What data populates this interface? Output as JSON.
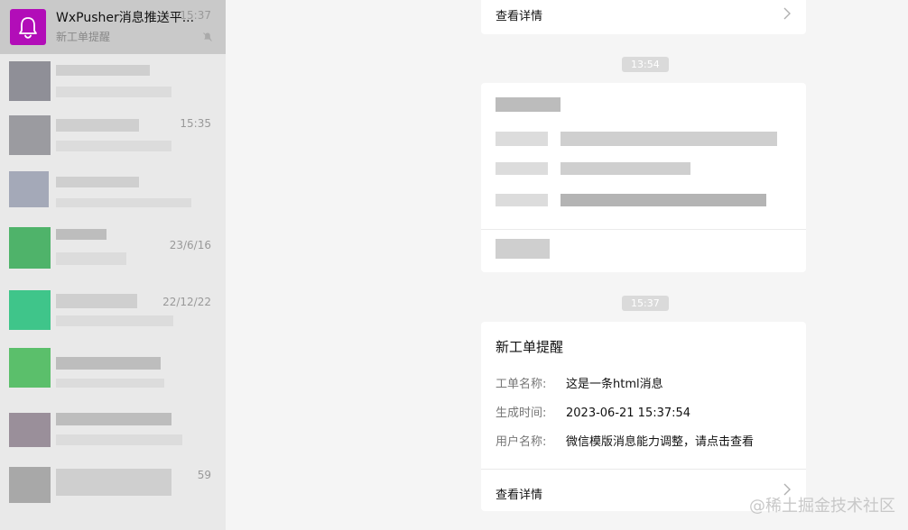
{
  "sidebar": {
    "active_chat": {
      "name": "WxPusher消息推送平...",
      "time": "15:37",
      "preview": "新工单提醒",
      "avatar_icon": "bell-icon",
      "avatar_color": "#b20db8"
    },
    "other_items": [
      {
        "time": ""
      },
      {
        "time": "15:35"
      },
      {
        "time": ""
      },
      {
        "time": "23/6/16"
      },
      {
        "time": "22/12/22"
      },
      {
        "time": ""
      },
      {
        "time": ""
      },
      {
        "time": "59"
      }
    ]
  },
  "chat": {
    "top_card": {
      "detail_label": "查看详情"
    },
    "time_1": "13:54",
    "time_2": "15:37",
    "notify_card": {
      "title": "新工单提醒",
      "fields": [
        {
          "label": "工单名称:",
          "value": "这是一条html消息"
        },
        {
          "label": "生成时间:",
          "value": "2023-06-21 15:37:54"
        },
        {
          "label": "用户名称:",
          "value": "微信模版消息能力调整，请点击查看"
        }
      ],
      "detail_label": "查看详情"
    }
  },
  "watermark": "@稀土掘金技术社区"
}
